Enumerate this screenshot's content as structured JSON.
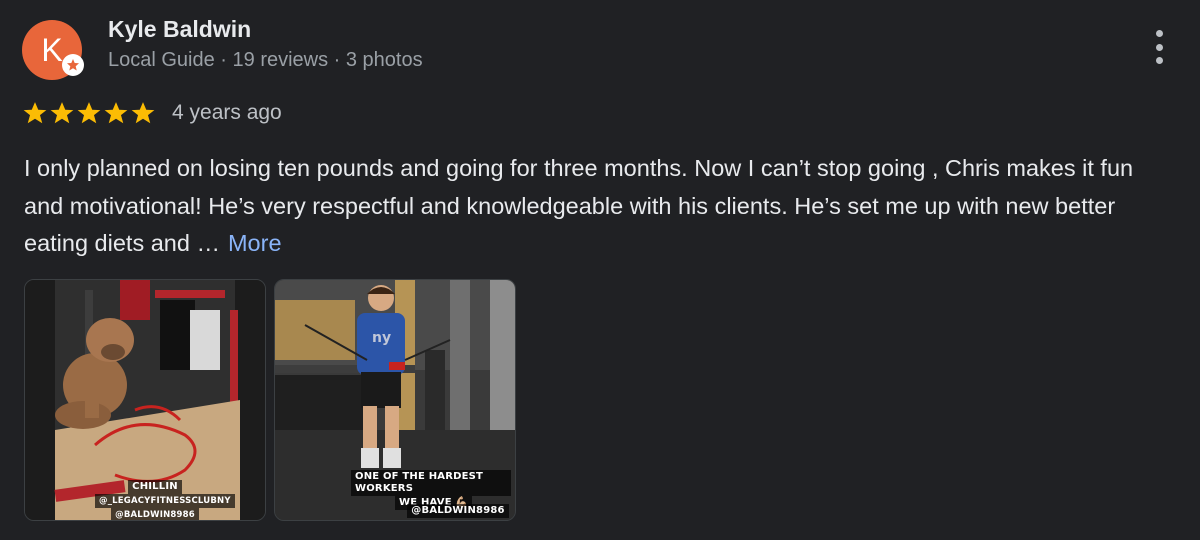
{
  "reviewer": {
    "avatar_letter": "K",
    "avatar_color": "#e8663a",
    "name": "Kyle Baldwin",
    "meta": "Local Guide · 19 reviews · 3 photos",
    "badge_icon": "local-guide-badge-icon"
  },
  "menu_icon": "more-vert-icon",
  "rating": {
    "stars": 5,
    "max": 5,
    "star_color": "#fbbc04",
    "time_ago": "4 years ago"
  },
  "review": {
    "text": "I only planned on losing ten pounds and going for three months. Now I can’t stop going , Chris makes it fun and motivational! He’s very respectful and knowledgeable with his clients. He’s set me up with new better eating diets and …",
    "more_label": "More",
    "link_color": "#8ab4f8"
  },
  "photos": [
    {
      "caption_lines": [
        "CHILLIN",
        "@_LEGACYFITNESSCLUBNY",
        "@BALDWIN8986"
      ]
    },
    {
      "caption_lines": [
        "ONE OF THE HARDEST WORKERS",
        "WE HAVE 💪🏼"
      ],
      "tag": "@BALDWIN8986"
    }
  ]
}
